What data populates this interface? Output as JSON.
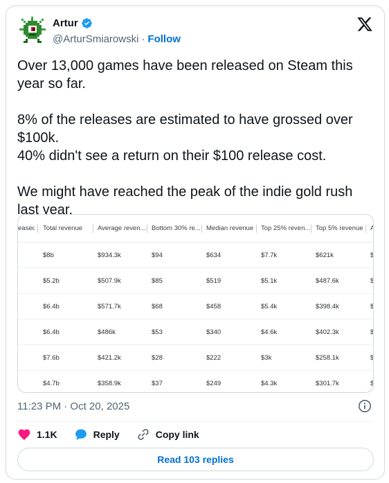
{
  "author": {
    "name": "Artur",
    "handle": "@ArturSmiarowski",
    "follow_label": "Follow",
    "verified": true
  },
  "tweet": {
    "paragraphs": [
      "Over 13,000 games have been released on Steam this year so far.",
      "8% of the releases are estimated to have grossed over $100k.",
      "40% didn't see a return on their $100 release cost.",
      "We might have reached the peak of the indie gold rush last year."
    ]
  },
  "media_table": {
    "columns": [
      "eased",
      "Total revenue",
      "Average reven...",
      "Bottom 30% re...",
      "Median revenue",
      "Top 25% reven...",
      "Top 5% revenue",
      "A"
    ],
    "rows": [
      [
        "",
        "$8b",
        "$934.3k",
        "$94",
        "$634",
        "$7.7k",
        "$621k",
        "$"
      ],
      [
        "",
        "$5.2b",
        "$507.9k",
        "$85",
        "$519",
        "$5.1k",
        "$487.6k",
        "$"
      ],
      [
        "",
        "$6.4b",
        "$571.7k",
        "$68",
        "$458",
        "$5.4k",
        "$398.4k",
        "$"
      ],
      [
        "",
        "$6.4b",
        "$486k",
        "$53",
        "$340",
        "$4.6k",
        "$402.3k",
        "$"
      ],
      [
        "",
        "$7.6b",
        "$421.2k",
        "$28",
        "$222",
        "$3k",
        "$258.1k",
        "$"
      ],
      [
        "",
        "$4.7b",
        "$358.9k",
        "$37",
        "$249",
        "$4.3k",
        "$301.7k",
        "$"
      ]
    ]
  },
  "timestamp": "11:23 PM · Oct 20, 2025",
  "actions": {
    "likes": "1.1K",
    "reply_label": "Reply",
    "copy_link_label": "Copy link"
  },
  "read_replies_label": "Read 103 replies",
  "colors": {
    "accent": "#006fd6",
    "like": "#f91880",
    "reply_bubble": "#1d9bf0",
    "verified": "#1d9bf0",
    "muted": "#536471"
  }
}
